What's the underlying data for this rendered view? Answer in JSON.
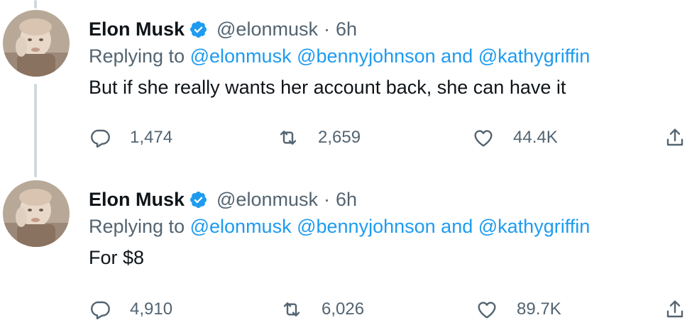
{
  "tweets": [
    {
      "author": {
        "name": "Elon Musk",
        "handle": "@elonmusk",
        "time": "6h"
      },
      "reply": {
        "prefix": "Replying to",
        "mention1": "@elonmusk",
        "mention2": "@bennyjohnson",
        "conj": "and",
        "mention3": "@kathygriffin"
      },
      "text": "But if she really wants her account back, she can have it",
      "stats": {
        "replies": "1,474",
        "retweets": "2,659",
        "likes": "44.4K"
      }
    },
    {
      "author": {
        "name": "Elon Musk",
        "handle": "@elonmusk",
        "time": "6h"
      },
      "reply": {
        "prefix": "Replying to",
        "mention1": "@elonmusk",
        "mention2": "@bennyjohnson",
        "conj": "and",
        "mention3": "@kathygriffin"
      },
      "text": "For $8",
      "stats": {
        "replies": "4,910",
        "retweets": "6,026",
        "likes": "89.7K"
      }
    }
  ],
  "icons": {
    "verified": "verified-badge-icon",
    "reply": "reply-icon",
    "retweet": "retweet-icon",
    "like": "like-icon",
    "share": "share-icon"
  },
  "colors": {
    "link": "#1d9bf0",
    "secondary": "#536471",
    "text": "#0f1419",
    "thread": "#cfd9de"
  }
}
